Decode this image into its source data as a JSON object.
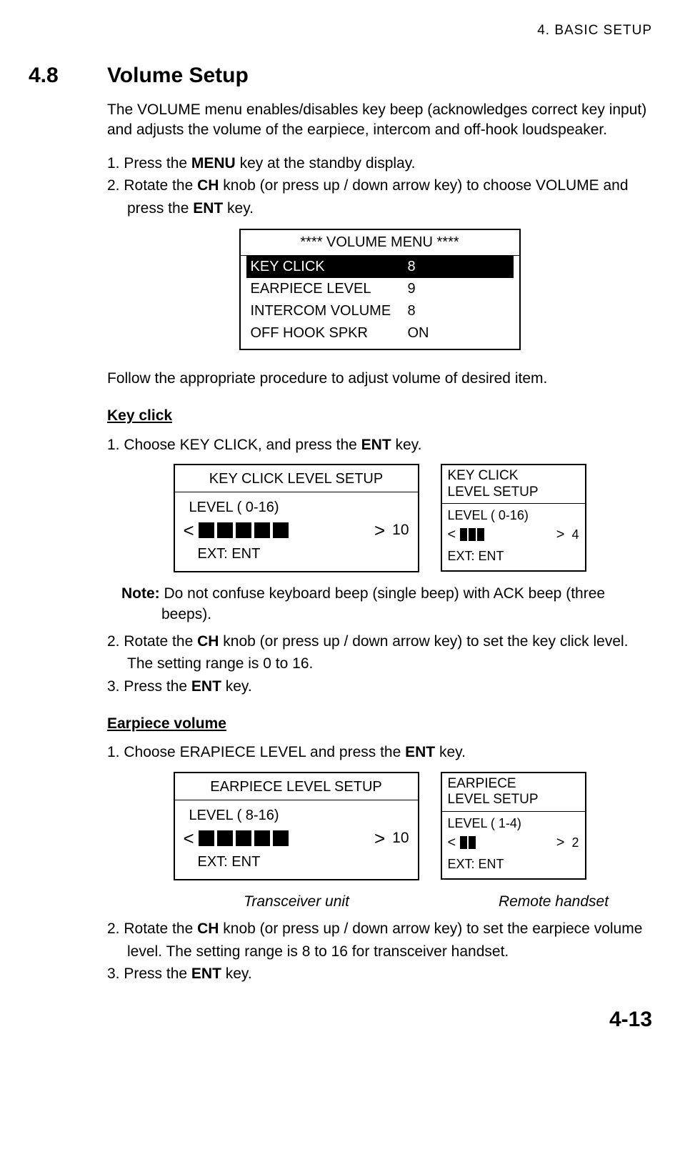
{
  "running_head": "4.  BASIC  SETUP",
  "section_number": "4.8",
  "section_title": "Volume Setup",
  "intro": "The VOLUME menu enables/disables key beep (acknowledges correct key input) and adjusts the volume of the earpiece, intercom and off-hook loudspeaker.",
  "steps_intro": {
    "s1_a": "1. Press the ",
    "s1_b": "MENU",
    "s1_c": " key at the standby display.",
    "s2_a": "2. Rotate the ",
    "s2_b": "CH",
    "s2_c": " knob (or press up / down arrow key) to choose VOLUME and",
    "s2_d": "press the ",
    "s2_e": "ENT",
    "s2_f": " key."
  },
  "vol_menu": {
    "title": "**** VOLUME MENU ****",
    "rows": [
      {
        "label": "KEY CLICK",
        "value": "8",
        "selected": true
      },
      {
        "label": "EARPIECE LEVEL",
        "value": "9",
        "selected": false
      },
      {
        "label": "INTERCOM VOLUME",
        "value": "8",
        "selected": false
      },
      {
        "label": "OFF HOOK SPKR",
        "value": "ON",
        "selected": false
      }
    ]
  },
  "follow_text": "Follow the appropriate procedure to adjust volume of desired item.",
  "keyclick": {
    "heading": "Key click",
    "s1_a": "1. Choose KEY CLICK, and press the ",
    "s1_b": "ENT",
    "s1_c": " key.",
    "panel_lg": {
      "title": "KEY CLICK LEVEL SETUP",
      "level_label": "LEVEL  ( 0-16)",
      "bars": 5,
      "value": "10",
      "ext": "EXT: ENT"
    },
    "panel_sm": {
      "title_l1": "KEY CLICK",
      "title_l2": "LEVEL SETUP",
      "level_label": "LEVEL  ( 0-16)",
      "bars": 3,
      "value": "4",
      "ext": "EXT: ENT"
    },
    "note_label": "Note:",
    "note_a": " Do not confuse keyboard beep (single beep) with ACK beep (three",
    "note_b": "beeps).",
    "s2_a": "2. Rotate the ",
    "s2_b": "CH",
    "s2_c": " knob (or press up / down arrow key) to set the key click level.",
    "s2_d": "The setting range is 0 to 16.",
    "s3_a": "3. Press the ",
    "s3_b": "ENT",
    "s3_c": " key."
  },
  "earpiece": {
    "heading": "Earpiece volume",
    "s1_a": "1. Choose ERAPIECE LEVEL and press the ",
    "s1_b": "ENT",
    "s1_c": " key.",
    "panel_lg": {
      "title": "EARPIECE LEVEL SETUP",
      "level_label": "LEVEL  ( 8-16)",
      "bars": 5,
      "value": "10",
      "ext": "EXT: ENT"
    },
    "panel_sm": {
      "title_l1": "EARPIECE",
      "title_l2": "LEVEL SETUP",
      "level_label": "LEVEL  ( 1-4)",
      "bars": 2,
      "value": "2",
      "ext": "EXT: ENT"
    },
    "caption_left": "Transceiver unit",
    "caption_right": "Remote handset",
    "s2_a": "2. Rotate the ",
    "s2_b": "CH",
    "s2_c": " knob (or press up / down arrow key) to set the earpiece volume",
    "s2_d": "level. The setting range is 8 to 16 for transceiver handset.",
    "s3_a": "3. Press the ",
    "s3_b": "ENT",
    "s3_c": " key."
  },
  "page_number": "4-13",
  "glyphs": {
    "lt": "<",
    "gt": ">"
  }
}
